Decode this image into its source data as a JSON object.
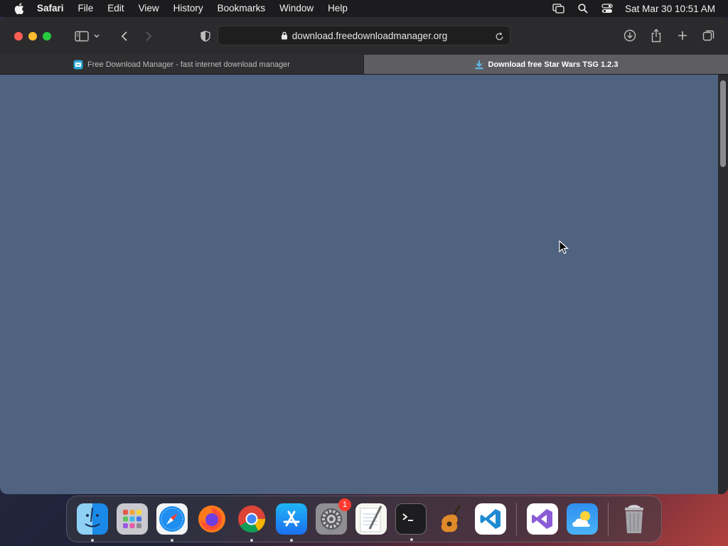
{
  "menubar": {
    "app_name": "Safari",
    "items": [
      "File",
      "Edit",
      "View",
      "History",
      "Bookmarks",
      "Window",
      "Help"
    ],
    "clock": "Sat Mar 30  10:51 AM",
    "icons": [
      "apple-icon",
      "screen-mirroring-icon",
      "spotlight-search-icon",
      "control-center-icon"
    ]
  },
  "toolbar": {
    "url": "download.freedownloadmanager.org",
    "icons": [
      "sidebar-icon",
      "chevron-down-icon",
      "back-icon",
      "forward-icon",
      "privacy-shield-icon",
      "lock-icon",
      "reload-icon",
      "downloads-icon",
      "share-icon",
      "new-tab-icon",
      "tab-overview-icon"
    ]
  },
  "tabs": [
    {
      "title": "Free Download Manager - fast internet download manager",
      "active": false
    },
    {
      "title": "Download free Star Wars TSG 1.2.3",
      "active": true
    }
  ],
  "dock": {
    "apps": [
      "Finder",
      "Launchpad",
      "Safari",
      "Firefox",
      "Google Chrome",
      "App Store",
      "System Settings",
      "TextEdit",
      "Terminal",
      "GarageBand",
      "Visual Studio Code",
      "Visual Studio",
      "Weather",
      "Trash"
    ],
    "system_settings_badge": "1"
  },
  "colors": {
    "content_background": "#4f6280",
    "active_tab": "#5e5e62"
  }
}
